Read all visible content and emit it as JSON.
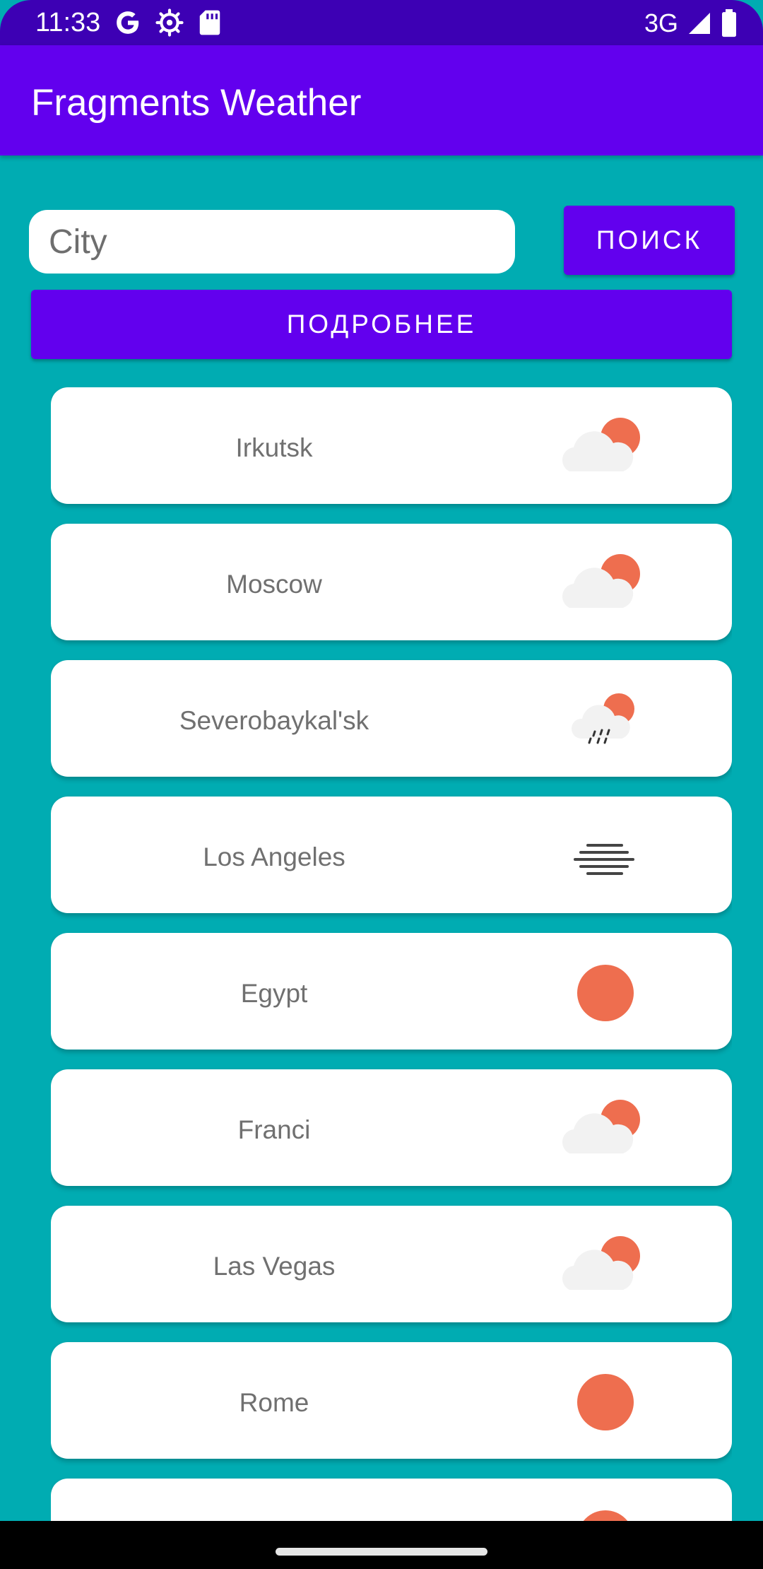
{
  "status_bar": {
    "time": "11:33",
    "network": "3G",
    "icons": [
      "google-icon",
      "settings-gear-icon",
      "sd-card-icon",
      "signal-icon",
      "battery-icon"
    ]
  },
  "app_bar": {
    "title": "Fragments Weather",
    "color": "#6200ee"
  },
  "search": {
    "placeholder": "City",
    "value": "",
    "search_button": "ПОИСК",
    "details_button": "ПОДРОБНЕЕ"
  },
  "colors": {
    "background": "#00acb2",
    "primary": "#6200ee",
    "sun": "#ee6e4f",
    "cloud": "#f2f2f2"
  },
  "cities": [
    {
      "name": "Irkutsk",
      "icon": "partly-cloudy-icon"
    },
    {
      "name": "Moscow",
      "icon": "partly-cloudy-icon"
    },
    {
      "name": "Severobaykal'sk",
      "icon": "rain-icon"
    },
    {
      "name": "Los Angeles",
      "icon": "fog-icon"
    },
    {
      "name": "Egypt",
      "icon": "sun-icon"
    },
    {
      "name": "Franci",
      "icon": "partly-cloudy-icon"
    },
    {
      "name": "Las Vegas",
      "icon": "partly-cloudy-icon"
    },
    {
      "name": "Rome",
      "icon": "sun-icon"
    },
    {
      "name": "",
      "icon": "sun-icon"
    }
  ]
}
